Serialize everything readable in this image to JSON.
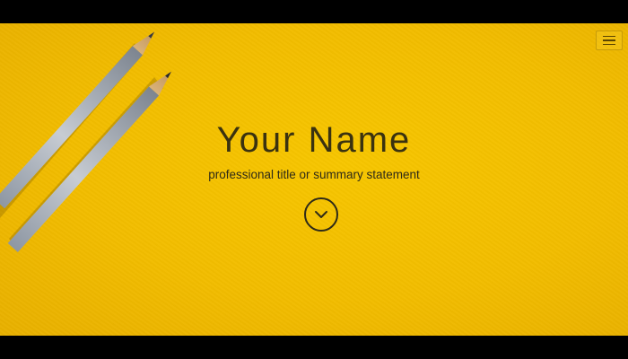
{
  "hero": {
    "name": "Your Name",
    "subtitle": "professional title or summary statement",
    "background_color": "#f2bd00",
    "text_color": "#3a3210"
  },
  "nav": {
    "menu_icon": "hamburger-menu-icon"
  },
  "scroll": {
    "icon": "chevron-down-icon"
  }
}
